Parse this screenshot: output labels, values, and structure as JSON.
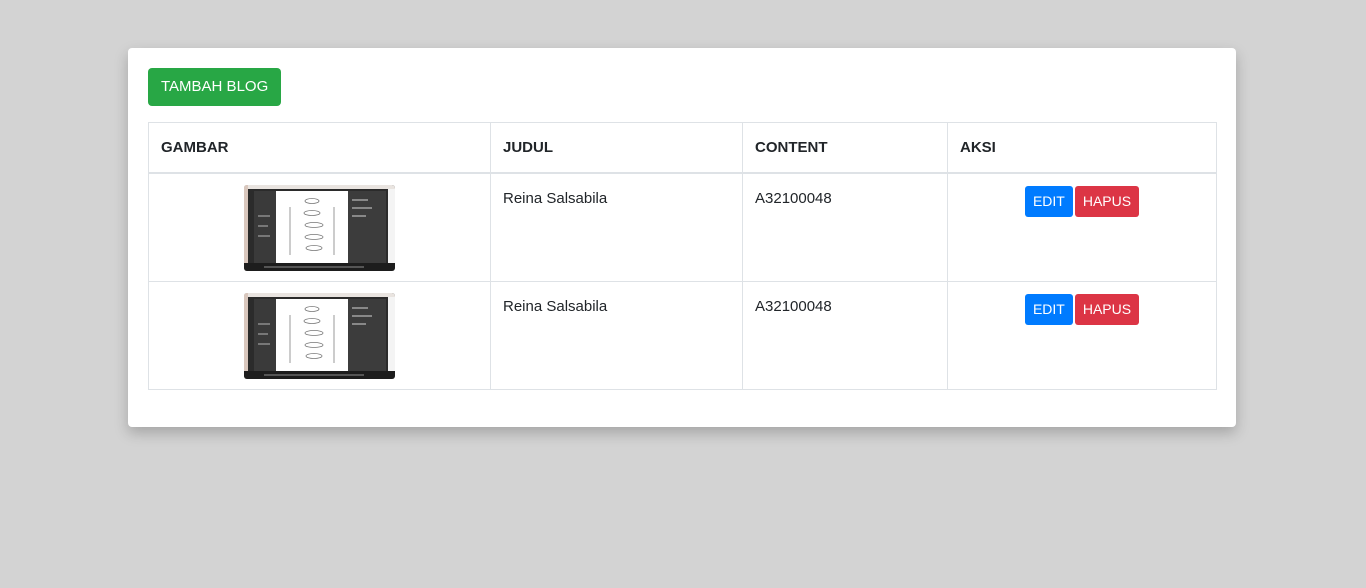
{
  "actions": {
    "add_label": "TAMBAH BLOG"
  },
  "table": {
    "headers": [
      "GAMBAR",
      "JUDUL",
      "CONTENT",
      "AKSI"
    ],
    "rows": [
      {
        "judul": "Reina Salsabila",
        "content": "A32100048",
        "edit_label": "EDIT",
        "hapus_label": "HAPUS"
      },
      {
        "judul": "Reina Salsabila",
        "content": "A32100048",
        "edit_label": "EDIT",
        "hapus_label": "HAPUS"
      }
    ]
  },
  "colors": {
    "add": "#28a745",
    "edit": "#007bff",
    "hapus": "#dc3545",
    "background": "#d3d3d3"
  }
}
